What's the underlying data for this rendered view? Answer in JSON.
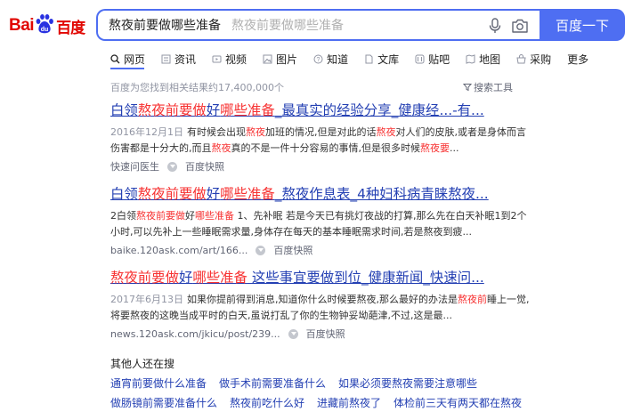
{
  "logo": {
    "text_bai": "Bai",
    "text_du": "du",
    "text_cn": "百度"
  },
  "search": {
    "query": "熬夜前要做哪些准备",
    "placeholder_ghost": "熬夜前要做哪些准备",
    "button": "百度一下"
  },
  "tabs": [
    {
      "label": "网页",
      "icon": "search-icon"
    },
    {
      "label": "资讯",
      "icon": "news-icon"
    },
    {
      "label": "视频",
      "icon": "video-icon"
    },
    {
      "label": "图片",
      "icon": "image-icon"
    },
    {
      "label": "知道",
      "icon": "question-icon"
    },
    {
      "label": "文库",
      "icon": "document-icon"
    },
    {
      "label": "贴吧",
      "icon": "tieba-icon"
    },
    {
      "label": "地图",
      "icon": "map-icon"
    },
    {
      "label": "采购",
      "icon": "purchase-icon"
    },
    {
      "label": "更多",
      "icon": ""
    }
  ],
  "result_meta": "百度为您找到相关结果约17,400,000个",
  "tools": "搜索工具",
  "results": [
    {
      "title_a": "白领",
      "title_b": "熬夜前要做",
      "title_c": "好",
      "title_d": "哪些准备",
      "title_e": "_最真实的经验分享_健康经...-有...",
      "date": "2016年12月1日",
      "body_1": "有时候会出现",
      "body_hl1": "熬夜",
      "body_2": "加班的情况,但是对此的话",
      "body_hl2": "熬夜",
      "body_3": "对人们的皮肤,或者是身体而言伤害都是十分大的,而且",
      "body_hl3": "熬夜",
      "body_4": "真的不是一件十分容易的事情,但是很多时候",
      "body_hl4": "熬夜要",
      "body_5": "...",
      "source": "快速问医生",
      "snapshot": "百度快照"
    },
    {
      "title_a": "白领",
      "title_b": "熬夜前要做",
      "title_c": "好",
      "title_d": "哪些准备",
      "title_e": "_熬夜作息表_4种妇科病青睐熬夜...",
      "date": "",
      "body_1": "2白领",
      "body_hl1": "熬夜前要做",
      "body_2": "好",
      "body_hl2": "哪些准备",
      "body_3": " 1、先补眠 若是今天已有挑灯夜战的打算,那么先在白天补眠1到2个小时,可以先补上一些睡眠需求量,身体存在每天的基本睡眠需求时间,若是熬夜到疲...",
      "body_hl3": "",
      "body_4": "",
      "body_hl4": "",
      "body_5": "",
      "source": "baike.120ask.com/art/166...",
      "snapshot": "百度快照"
    },
    {
      "title_a": "",
      "title_b": "熬夜前要做",
      "title_c": "好",
      "title_d": "哪些准备",
      "title_e": " 这些事宜要做到位_健康新闻_快速问...",
      "date": "2017年6月13日",
      "body_1": "如果你提前得到消息,知道你什么时候要熬夜,那么最好的办法是",
      "body_hl1": "熬夜前",
      "body_2": "睡上一觉,将要熬夜的这晚当成平时的白天,虽说打乱了你的生物钟妥坳葩津,不过,这是最...",
      "body_hl2": "",
      "body_3": "",
      "body_hl3": "",
      "body_4": "",
      "body_hl4": "",
      "body_5": "",
      "source": "news.120ask.com/jkicu/post/239...",
      "snapshot": "百度快照"
    }
  ],
  "related": {
    "title": "其他人还在搜",
    "row1": [
      "通宵前要做什么准备",
      "做手术前需要准备什么",
      "如果必须要熬夜需要注意哪些"
    ],
    "row2": [
      "做肠镜前需要准备什么",
      "熬夜前吃什么好",
      "进藏前熬夜了",
      "体检前三天有两天都在熬夜"
    ]
  },
  "colors": {
    "brand_blue": "#4e6ef2",
    "link_blue": "#2440b3",
    "highlight_red": "#f73131",
    "logo_red": "#e10601"
  }
}
